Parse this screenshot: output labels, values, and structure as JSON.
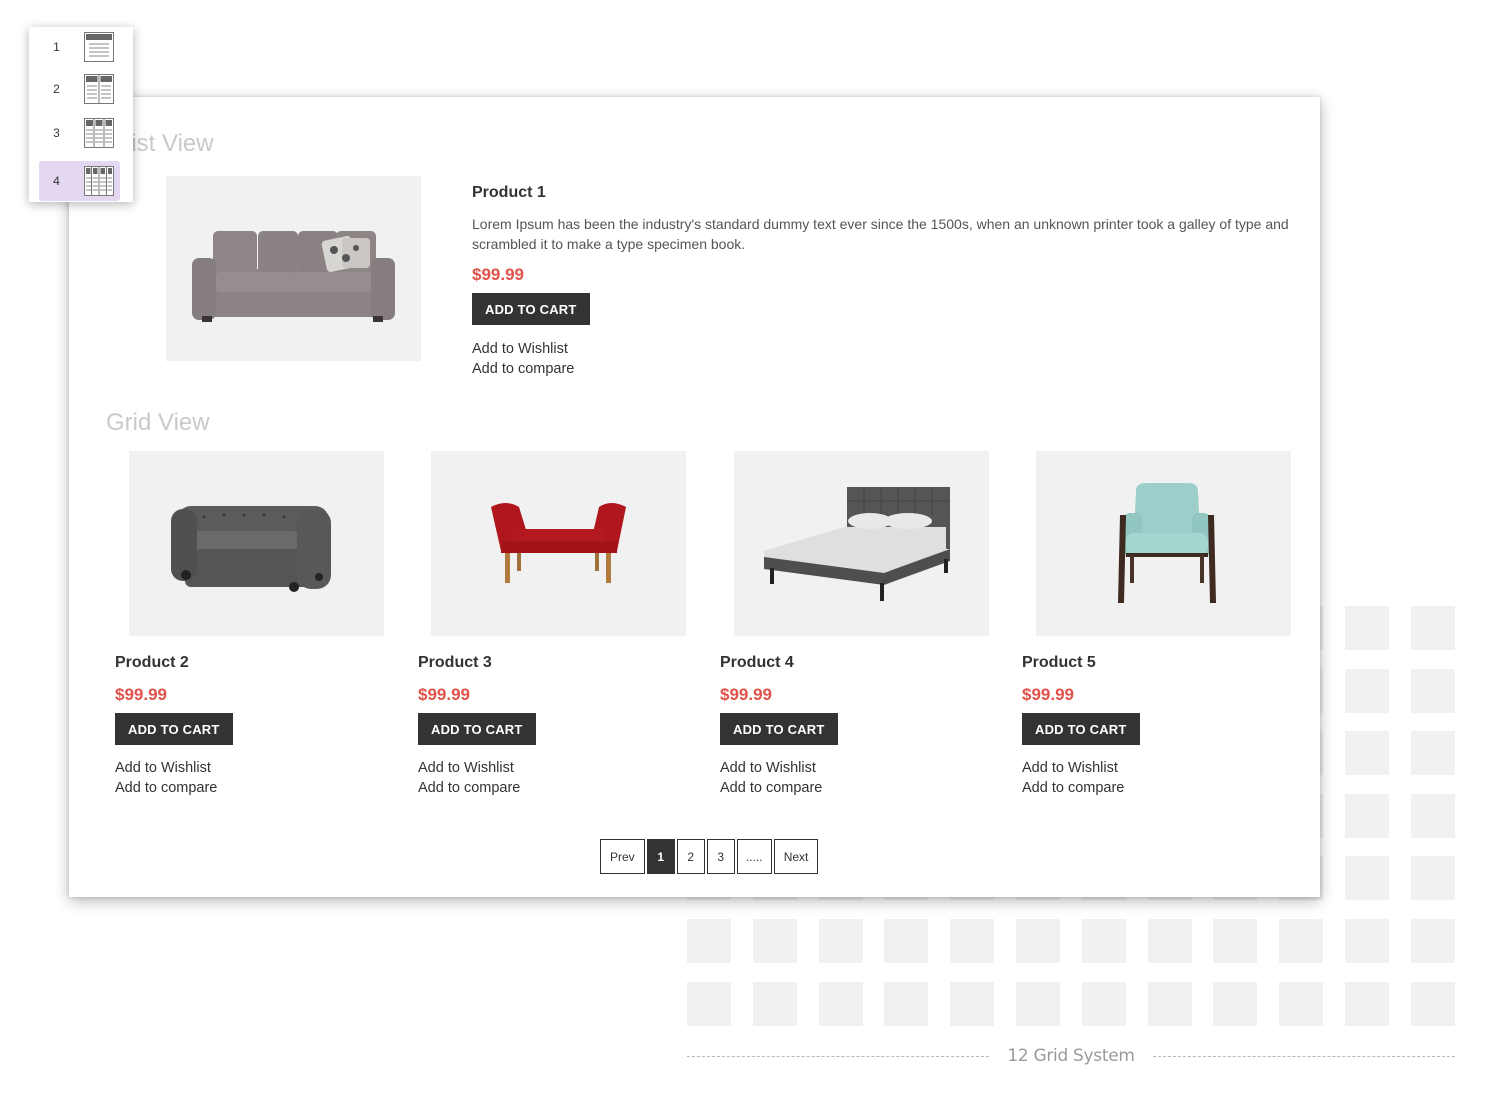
{
  "column_picker": {
    "options": [
      {
        "label": "1",
        "icon": "one-column-layout-icon",
        "columns": 1,
        "selected": false
      },
      {
        "label": "2",
        "icon": "two-column-layout-icon",
        "columns": 2,
        "selected": false
      },
      {
        "label": "3",
        "icon": "three-column-layout-icon",
        "columns": 3,
        "selected": false
      },
      {
        "label": "4",
        "icon": "four-column-layout-icon",
        "columns": 4,
        "selected": true
      }
    ],
    "selected_color": "#e4d7f2"
  },
  "list_view": {
    "title": "List View",
    "product": {
      "name": "Product 1",
      "description": "Lorem Ipsum has been the industry's standard dummy text ever since the 1500s, when an unknown printer took a galley of type and scrambled it to make a type specimen book.",
      "price": "$99.99",
      "image": "grey-sofa",
      "add_to_cart": "ADD TO CART",
      "wishlist": "Add to Wishlist",
      "compare": "Add to compare"
    }
  },
  "grid_view": {
    "title": "Grid View",
    "products": [
      {
        "name": "Product 2",
        "price": "$99.99",
        "image": "chesterfield-loveseat",
        "add_to_cart": "ADD TO CART",
        "wishlist": "Add to Wishlist",
        "compare": "Add to compare"
      },
      {
        "name": "Product 3",
        "price": "$99.99",
        "image": "red-bench",
        "add_to_cart": "ADD TO CART",
        "wishlist": "Add to Wishlist",
        "compare": "Add to compare"
      },
      {
        "name": "Product 4",
        "price": "$99.99",
        "image": "grey-bed",
        "add_to_cart": "ADD TO CART",
        "wishlist": "Add to Wishlist",
        "compare": "Add to compare"
      },
      {
        "name": "Product 5",
        "price": "$99.99",
        "image": "mint-armchair",
        "add_to_cart": "ADD TO CART",
        "wishlist": "Add to Wishlist",
        "compare": "Add to compare"
      }
    ]
  },
  "pagination": {
    "prev": "Prev",
    "pages": [
      "1",
      "2",
      "3"
    ],
    "ellipsis": ".....",
    "next": "Next",
    "current": "1"
  },
  "grid_system": {
    "caption": "12 Grid System",
    "columns": 12
  },
  "colors": {
    "price": "#e0524a",
    "button": "#333333",
    "placeholder": "#f1f1f1"
  }
}
